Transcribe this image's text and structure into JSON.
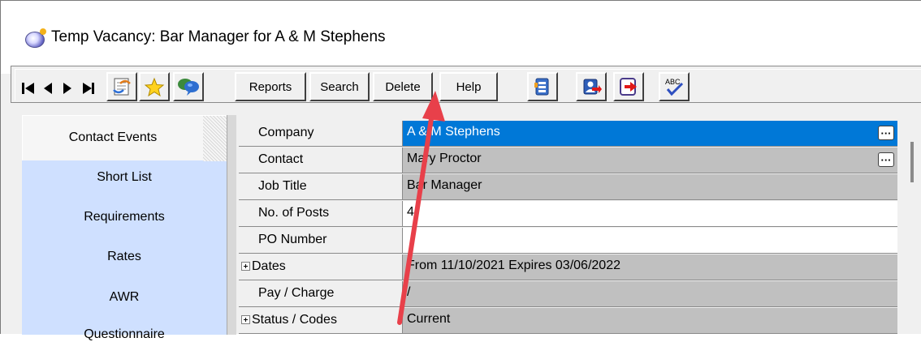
{
  "window": {
    "title": "Temp Vacancy: Bar Manager for A & M Stephens"
  },
  "toolbar": {
    "reports_label": "Reports",
    "search_label": "Search",
    "delete_label": "Delete",
    "help_label": "Help",
    "abc_label": "ABC"
  },
  "sidebar": {
    "items": [
      {
        "label": "Contact Events"
      },
      {
        "label": "Short List"
      },
      {
        "label": "Requirements"
      },
      {
        "label": "Rates"
      },
      {
        "label": "AWR"
      },
      {
        "label": "Questionnaire"
      }
    ]
  },
  "fields": [
    {
      "label": "Company",
      "value": "A & M Stephens"
    },
    {
      "label": "Contact",
      "value": "Mary Proctor"
    },
    {
      "label": "Job Title",
      "value": "Bar Manager"
    },
    {
      "label": "No. of Posts",
      "value": "4"
    },
    {
      "label": "PO Number",
      "value": ""
    },
    {
      "label": "Dates",
      "value": "From 11/10/2021 Expires 03/06/2022"
    },
    {
      "label": "Pay / Charge",
      "value": "/"
    },
    {
      "label": "Status / Codes",
      "value": "Current"
    }
  ],
  "colors": {
    "selection": "#0078d7",
    "sidebar": "#cfe0ff",
    "annotation_arrow": "#e8404a"
  }
}
